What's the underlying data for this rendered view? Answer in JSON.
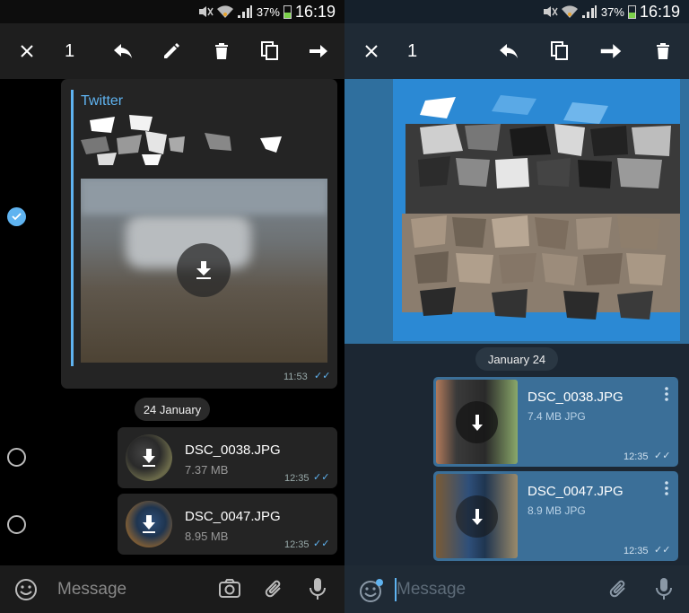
{
  "status_bar": {
    "battery": "37%",
    "time": "16:19"
  },
  "left": {
    "toolbar": {
      "count": "1"
    },
    "link_preview": {
      "site": "Twitter",
      "time": "11:53"
    },
    "date_pill": "24 January",
    "files": [
      {
        "name": "DSC_0038.JPG",
        "size": "7.37 MB",
        "time": "12:35"
      },
      {
        "name": "DSC_0047.JPG",
        "size": "8.95 MB",
        "time": "12:35"
      }
    ],
    "input": {
      "placeholder": "Message"
    }
  },
  "right": {
    "toolbar": {
      "count": "1"
    },
    "date_pill": "January 24",
    "files": [
      {
        "name": "DSC_0038.JPG",
        "size": "7.4 MB JPG",
        "time": "12:35"
      },
      {
        "name": "DSC_0047.JPG",
        "size": "8.9 MB JPG",
        "time": "12:35"
      }
    ],
    "input": {
      "placeholder": "Message"
    }
  },
  "colors": {
    "accent": "#5fb3f0",
    "bubble_dark": "#242424",
    "bubble_blue": "#3b6f98",
    "right_bg": "#1c2733"
  }
}
